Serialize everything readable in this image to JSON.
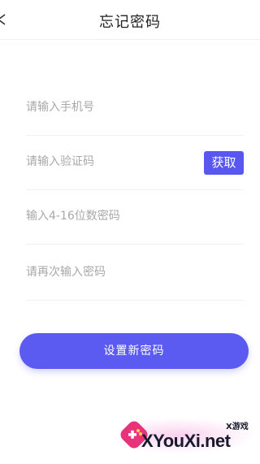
{
  "header": {
    "title": "忘记密码",
    "back_icon": "chevron-left-icon"
  },
  "form": {
    "phone_placeholder": "请输入手机号",
    "code_placeholder": "请输入验证码",
    "get_code_label": "获取",
    "password_placeholder": "输入4-16位数密码",
    "confirm_placeholder": "请再次输入密码"
  },
  "submit": {
    "label": "设置新密码"
  },
  "watermark": {
    "small_text": "X游戏",
    "big_text": "XYouXi.net"
  },
  "colors": {
    "accent": "#5858f0",
    "logo_pink": "#e8337a"
  }
}
